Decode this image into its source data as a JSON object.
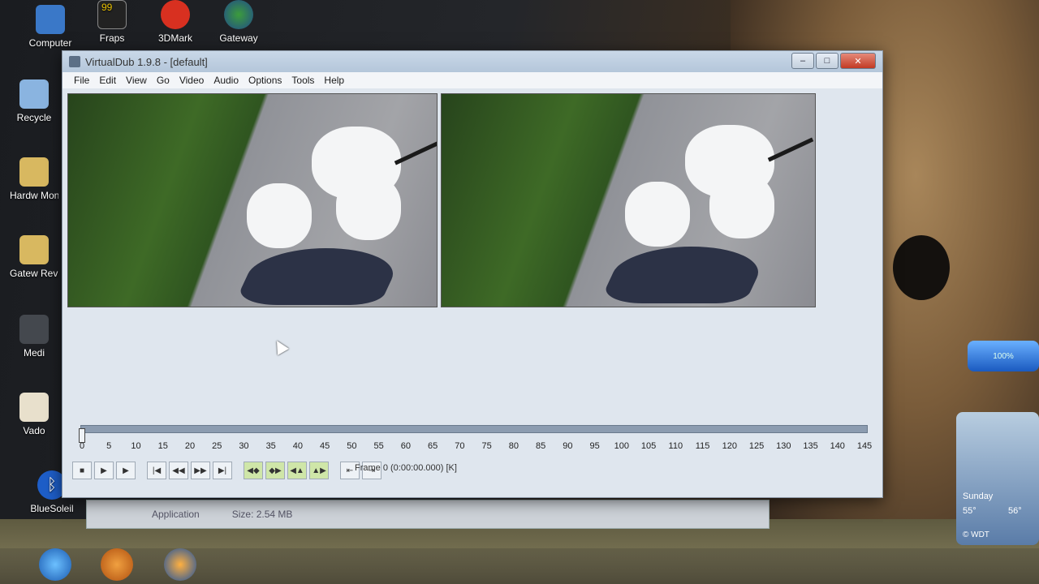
{
  "desktop": {
    "icons": [
      {
        "label": "Computer",
        "icon": "computer-icon"
      },
      {
        "label": "Fraps",
        "icon": "fraps-icon",
        "badge": "99"
      },
      {
        "label": "3DMark",
        "icon": "3dmark-icon"
      },
      {
        "label": "Gateway",
        "icon": "gateway-icon"
      },
      {
        "label": "Recycle",
        "icon": "recycle-bin-icon"
      },
      {
        "label": "Hardw Monit",
        "icon": "folder-icon"
      },
      {
        "label": "Gatew Revie",
        "icon": "folder-icon"
      },
      {
        "label": "Medi",
        "icon": "media-icon"
      },
      {
        "label": "Vado",
        "icon": "folder-icon"
      },
      {
        "label": "BlueSoleil",
        "icon": "bluetooth-icon"
      }
    ]
  },
  "window": {
    "title": "VirtualDub 1.9.8 - [default]",
    "menu": [
      "File",
      "Edit",
      "View",
      "Go",
      "Video",
      "Audio",
      "Options",
      "Tools",
      "Help"
    ],
    "controls": {
      "minimize": "–",
      "maximize": "□",
      "close": "✕"
    },
    "timeline": {
      "ticks": [
        "0",
        "5",
        "10",
        "15",
        "20",
        "25",
        "30",
        "35",
        "40",
        "45",
        "50",
        "55",
        "60",
        "65",
        "70",
        "75",
        "80",
        "85",
        "90",
        "95",
        "100",
        "105",
        "110",
        "115",
        "120",
        "125",
        "130",
        "135",
        "140",
        "145"
      ],
      "position": 0
    },
    "toolbar": [
      {
        "icon": "stop-icon",
        "glyph": "■"
      },
      {
        "icon": "play-input-icon",
        "glyph": "▶"
      },
      {
        "icon": "play-output-icon",
        "glyph": "▶"
      },
      {
        "icon": "start-icon",
        "glyph": "|◀"
      },
      {
        "icon": "prev-frame-icon",
        "glyph": "◀◀"
      },
      {
        "icon": "next-frame-icon",
        "glyph": "▶▶"
      },
      {
        "icon": "end-icon",
        "glyph": "▶|"
      },
      {
        "icon": "prev-key-icon",
        "glyph": "◀◆"
      },
      {
        "icon": "next-key-icon",
        "glyph": "◆▶"
      },
      {
        "icon": "prev-scene-icon",
        "glyph": "◀▲"
      },
      {
        "icon": "next-scene-icon",
        "glyph": "▲▶"
      },
      {
        "icon": "mark-in-icon",
        "glyph": "⇤"
      },
      {
        "icon": "mark-out-icon",
        "glyph": "⇥"
      }
    ],
    "frame_status": "Frame 0 (0:00:00.000) [K]"
  },
  "background_window": {
    "type": "Application",
    "size": "Size: 2.54 MB"
  },
  "gadgets": {
    "gauge": "100%",
    "weather": {
      "day": "Sunday",
      "temp_left": "55°",
      "temp_right": "56°",
      "source": "© WDT"
    }
  }
}
